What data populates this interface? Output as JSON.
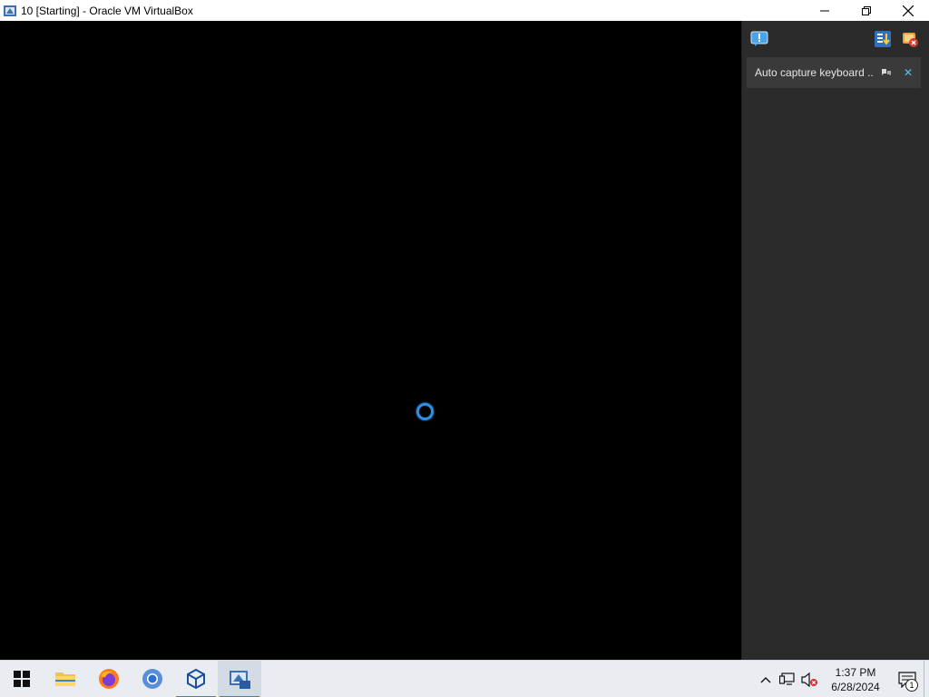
{
  "window": {
    "title": "10 [Starting] - Oracle VM VirtualBox",
    "icon": "virtualbox-vm-icon"
  },
  "window_controls": {
    "minimize_icon": "minimize-icon",
    "restore_icon": "restore-icon",
    "close_icon": "close-icon"
  },
  "vm_screen": {
    "state": "booting",
    "spinner_color": "#2f8fe6"
  },
  "notification_panel": {
    "top_left_icon": "notification-center-icon",
    "top_right_icons": [
      "sort-notifications-icon",
      "dismiss-all-icon"
    ],
    "message": "Auto capture keyboard ...",
    "more_icon": "more-info-icon",
    "close_icon": "close-notification-icon"
  },
  "taskbar": {
    "apps": [
      {
        "name": "start",
        "icon": "windows-start-icon"
      },
      {
        "name": "file-explorer",
        "icon": "folder-icon"
      },
      {
        "name": "firefox",
        "icon": "firefox-icon"
      },
      {
        "name": "chrome",
        "icon": "chrome-icon"
      },
      {
        "name": "virtualbox-manager",
        "icon": "virtualbox-icon"
      },
      {
        "name": "vm-window",
        "icon": "virtualbox-vm-icon",
        "active": true
      }
    ],
    "tray": {
      "chevron_icon": "show-hidden-icons-chevron",
      "network_icon": "network-icon",
      "volume_icon": "volume-muted-icon",
      "time": "1:37 PM",
      "date": "6/28/2024",
      "action_center_icon": "action-center-icon",
      "notification_count": "1"
    }
  },
  "colors": {
    "panel_bg": "#2b2b2b",
    "notification_bg": "#3a3a3a",
    "taskbar_bg": "#e9edf2",
    "accent": "#3f7fcf"
  }
}
